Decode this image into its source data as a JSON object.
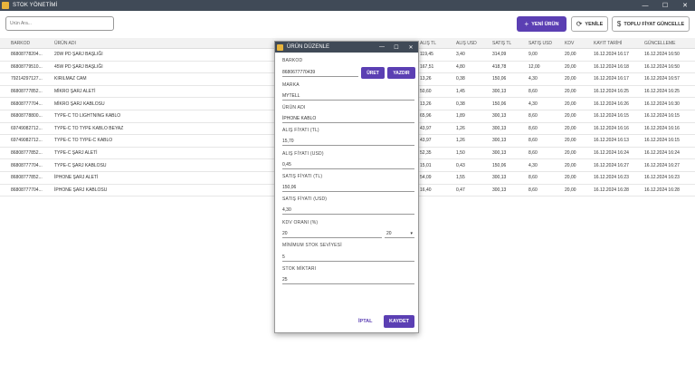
{
  "window": {
    "title": "STOK YÖNETİMİ",
    "minimize": "—",
    "maximize": "☐",
    "close": "✕"
  },
  "search": {
    "placeholder": "Ürün Ara..."
  },
  "toolbar": {
    "new_label": "YENİ ÜRÜN",
    "refresh_label": "YENİLE",
    "bulk_label": "TOPLU FİYAT GÜNCELLE"
  },
  "table": {
    "headers": [
      "BARKOD",
      "ÜRÜN ADI",
      "ALIŞ TL",
      "ALIŞ USD",
      "SATIŞ TL",
      "SATIŞ USD",
      "KDV",
      "KAYIT TARİHİ",
      "GÜNCELLEME"
    ],
    "rows": [
      [
        "86808778204...",
        "20W PD ŞARJ BAŞLIĞI",
        "119,45",
        "3,40",
        "314,09",
        "9,00",
        "20,00",
        "16.12.2024 16:17",
        "16.12.2024 16:50"
      ],
      [
        "86808779510...",
        "45W PD ŞARJ BAŞLIĞI",
        "167,51",
        "4,80",
        "418,78",
        "12,00",
        "20,00",
        "16.12.2024 16:18",
        "16.12.2024 16:50"
      ],
      [
        "79214297127...",
        "KIRILMAZ CAM",
        "13,26",
        "0,38",
        "150,06",
        "4,30",
        "20,00",
        "16.12.2024 16:17",
        "16.12.2024 16:57"
      ],
      [
        "86808777852...",
        "MİKRO ŞARJ ALETİ",
        "50,60",
        "1,45",
        "300,13",
        "8,60",
        "20,00",
        "16.12.2024 16:25",
        "16.12.2024 16:25"
      ],
      [
        "86808777704...",
        "MİKRO ŞARJ KABLOSU",
        "13,26",
        "0,38",
        "150,06",
        "4,30",
        "20,00",
        "16.12.2024 16:26",
        "16.12.2024 16:30"
      ],
      [
        "86808778800...",
        "TYPE-C TO LIGHTNING KABLO",
        "65,96",
        "1,89",
        "300,13",
        "8,60",
        "20,00",
        "16.12.2024 16:15",
        "16.12.2024 16:15"
      ],
      [
        "69749082712...",
        "TYPE-C TO TYPE KABLO BEYAZ",
        "43,97",
        "1,26",
        "300,13",
        "8,60",
        "20,00",
        "16.12.2024 16:16",
        "16.12.2024 16:16"
      ],
      [
        "69749082712...",
        "TYPE-C TO TYPE-C KABLO",
        "43,97",
        "1,26",
        "300,13",
        "8,60",
        "20,00",
        "16.12.2024 16:13",
        "16.12.2024 16:15"
      ],
      [
        "86808777852...",
        "TYPE-C ŞARJ ALETİ",
        "52,35",
        "1,50",
        "300,13",
        "8,60",
        "20,00",
        "16.12.2024 16:24",
        "16.12.2024 16:24"
      ],
      [
        "86808777704...",
        "TYPE-C ŞARJ KABLOSU",
        "15,01",
        "0,43",
        "150,06",
        "4,30",
        "20,00",
        "16.12.2024 16:27",
        "16.12.2024 16:27"
      ],
      [
        "86808777852...",
        "İPHONE ŞARJ ALETİ",
        "54,09",
        "1,55",
        "300,13",
        "8,60",
        "20,00",
        "16.12.2024 16:23",
        "16.12.2024 16:23"
      ],
      [
        "86808777704...",
        "İPHONE ŞARJ KABLOSU",
        "16,40",
        "0,47",
        "300,13",
        "8,60",
        "20,00",
        "16.12.2024 16:28",
        "16.12.2024 16:28"
      ]
    ]
  },
  "dialog": {
    "title": "ÜRÜN DÜZENLE",
    "barkod_label": "BARKOD",
    "barkod_value": "8680677770439",
    "uret_label": "ÜRET",
    "yazdir_label": "YAZDIR",
    "marka_label": "MARKA",
    "marka_value": "MYTELL",
    "urun_adi_label": "ÜRÜN ADI",
    "urun_adi_value": "İPHONE KABLO",
    "alis_tl_label": "ALIŞ FİYATI (TL)",
    "alis_tl_value": "15,70",
    "alis_usd_label": "ALIŞ FİYATI (USD)",
    "alis_usd_value": "0,45",
    "satis_tl_label": "SATIŞ FİYATI (TL)",
    "satis_tl_value": "150,06",
    "satis_usd_label": "SATIŞ FİYATI (USD)",
    "satis_usd_value": "4,30",
    "kdv_label": "KDV ORANI (%)",
    "kdv_value": "20",
    "kdv_select": "20",
    "min_stok_label": "MİNİMUM STOK SEVİYESİ",
    "min_stok_value": "5",
    "stok_label": "STOK MİKTARI",
    "stok_value": "25",
    "cancel_label": "İPTAL",
    "save_label": "KAYDET"
  },
  "colors": {
    "accent": "#5b3fb3",
    "titlebar": "#404a57"
  }
}
